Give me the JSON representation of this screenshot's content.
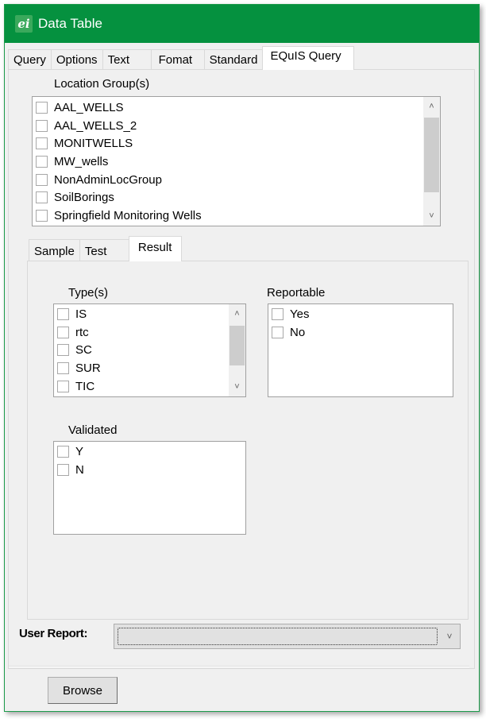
{
  "window": {
    "title": "Data Table",
    "app_icon": "ei-logo-icon",
    "accent_color": "#05913f"
  },
  "top_tabs": [
    {
      "label": "Query",
      "active": false
    },
    {
      "label": "Options",
      "active": false
    },
    {
      "label": "Text",
      "active": false
    },
    {
      "label": "Fomat",
      "active": false
    },
    {
      "label": "Standard",
      "active": false
    },
    {
      "label": "EQuIS Query",
      "active": true
    }
  ],
  "location_groups": {
    "label": "Location Group(s)",
    "items": [
      {
        "label": "AAL_WELLS",
        "checked": false
      },
      {
        "label": "AAL_WELLS_2",
        "checked": false
      },
      {
        "label": "MONITWELLS",
        "checked": false
      },
      {
        "label": "MW_wells",
        "checked": false
      },
      {
        "label": "NonAdminLocGroup",
        "checked": false
      },
      {
        "label": "SoilBorings",
        "checked": false
      },
      {
        "label": "Springfield Monitoring Wells",
        "checked": false
      }
    ]
  },
  "inner_tabs": [
    {
      "label": "Sample",
      "active": false
    },
    {
      "label": "Test",
      "active": false
    },
    {
      "label": "Result",
      "active": true
    }
  ],
  "types": {
    "label": "Type(s)",
    "items": [
      {
        "label": "IS",
        "checked": false
      },
      {
        "label": "rtc",
        "checked": false
      },
      {
        "label": "SC",
        "checked": false
      },
      {
        "label": "SUR",
        "checked": false
      },
      {
        "label": "TIC",
        "checked": false
      }
    ]
  },
  "reportable": {
    "label": "Reportable",
    "items": [
      {
        "label": "Yes",
        "checked": false
      },
      {
        "label": "No",
        "checked": false
      }
    ]
  },
  "validated": {
    "label": "Validated",
    "items": [
      {
        "label": "Y",
        "checked": false
      },
      {
        "label": "N",
        "checked": false
      }
    ]
  },
  "user_report": {
    "label": "User Report:",
    "value": ""
  },
  "browse_button": {
    "label": "Browse"
  },
  "icons": {
    "scroll_up": "^",
    "scroll_down": "v",
    "dropdown": "v"
  }
}
